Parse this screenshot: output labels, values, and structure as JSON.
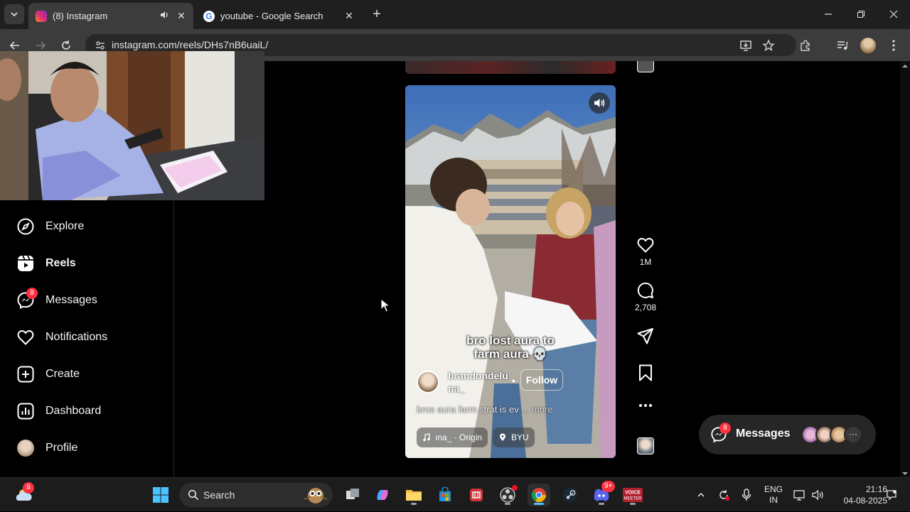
{
  "browser": {
    "tabs": [
      {
        "title": "(8) Instagram",
        "active": true
      },
      {
        "title": "youtube - Google Search",
        "active": false
      }
    ],
    "url": "instagram.com/reels/DHs7nB6uaiL/"
  },
  "sidebar": {
    "items": [
      {
        "label": "Explore",
        "icon": "compass-icon"
      },
      {
        "label": "Reels",
        "icon": "reels-icon"
      },
      {
        "label": "Messages",
        "icon": "messenger-icon",
        "badge": "8"
      },
      {
        "label": "Notifications",
        "icon": "heart-icon"
      },
      {
        "label": "Create",
        "icon": "plus-square-icon"
      },
      {
        "label": "Dashboard",
        "icon": "dashboard-icon"
      },
      {
        "label": "Profile",
        "icon": "avatar"
      }
    ]
  },
  "reel": {
    "caption_line1": "bro lost aura to",
    "caption_line2": "farm aura 💀",
    "username_line1": "brandondelu",
    "username_line2": "na_",
    "follow_label": "Follow",
    "description": "bros aura farm strat is ev",
    "more_label": "... more",
    "audio_label": "ına_ · Origin",
    "location_label": "BYU"
  },
  "actions": {
    "likes": "1M",
    "comments": "2,708"
  },
  "messages_bar": {
    "label": "Messages",
    "badge": "8",
    "overflow": "···"
  },
  "taskbar": {
    "search_label": "Search",
    "weather_badge": "8",
    "discord_badge": "9+",
    "lang_line1": "ENG",
    "lang_line2": "IN",
    "time": "21:16",
    "date": "04-08-2025"
  },
  "colors": {
    "instagram_badge": "#ff3040",
    "page_background": "#000000",
    "tab_strip": "#1f1f1f",
    "toolbar": "#3c3c3c"
  }
}
